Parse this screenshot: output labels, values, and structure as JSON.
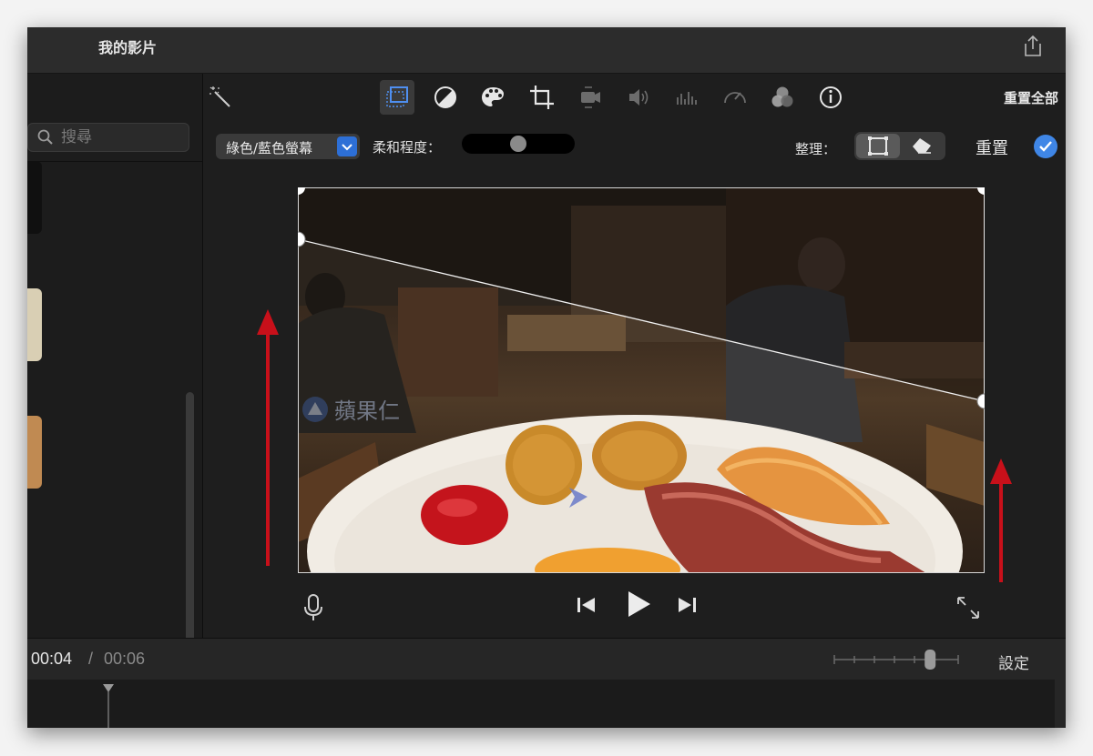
{
  "window": {
    "title": "我的影片"
  },
  "sidebar": {
    "search_placeholder": "搜尋"
  },
  "toolbar": {
    "tools": [
      {
        "name": "enhance-wand-icon",
        "active": false
      },
      {
        "name": "video-overlay-icon",
        "active": true
      },
      {
        "name": "color-balance-icon",
        "active": false
      },
      {
        "name": "color-correction-palette-icon",
        "active": false
      },
      {
        "name": "crop-icon",
        "active": false
      },
      {
        "name": "stabilization-icon",
        "active": false
      },
      {
        "name": "volume-icon",
        "active": false
      },
      {
        "name": "noise-reduction-icon",
        "active": false
      },
      {
        "name": "speed-icon",
        "active": false
      },
      {
        "name": "clip-filter-icon",
        "active": false
      },
      {
        "name": "info-icon",
        "active": false
      }
    ],
    "reset_all_label": "重置全部"
  },
  "overlay_controls": {
    "mode_select": "綠色/藍色螢幕",
    "softness_label": "柔和程度：",
    "softness_value": 0.5,
    "arrange_label": "整理：",
    "arrange_options": [
      "crop-frame-icon",
      "eraser-icon"
    ],
    "arrange_selected": 0,
    "reset_label": "重置"
  },
  "viewer": {
    "watermark": "蘋果仁"
  },
  "playback": {
    "current_time": "00:04",
    "separator": "/",
    "total_time": "00:06",
    "zoom_level": 0.8,
    "settings_label": "設定"
  },
  "colors": {
    "accent": "#3f86e6",
    "annotation_arrow": "#c8101a",
    "select_chevron": "#2d6fd6"
  }
}
